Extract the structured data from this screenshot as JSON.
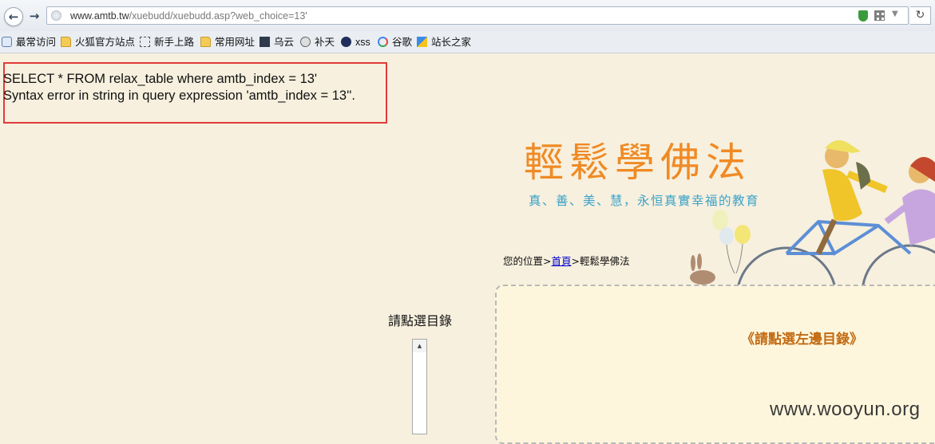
{
  "browser": {
    "url_host": "www.amtb.tw",
    "url_path": "/xuebudd/xuebudd.asp?web_choice=13'"
  },
  "bookmarks": [
    {
      "label": "最常访问",
      "icon": "star-page-icon"
    },
    {
      "label": "火狐官方站点",
      "icon": "folder-icon"
    },
    {
      "label": "新手上路",
      "icon": "dashed-page-icon"
    },
    {
      "label": "常用网址",
      "icon": "folder-icon"
    },
    {
      "label": "乌云",
      "icon": "wooyun-icon"
    },
    {
      "label": "补天",
      "icon": "star-icon"
    },
    {
      "label": "xss",
      "icon": "xss-icon"
    },
    {
      "label": "谷歌",
      "icon": "google-icon"
    },
    {
      "label": "站长之家",
      "icon": "zz-icon"
    }
  ],
  "error": {
    "line1": "SELECT * FROM relax_table where amtb_index = 13'",
    "line2": "Syntax error in string in query expression 'amtb_index = 13''."
  },
  "page": {
    "title": "輕鬆學佛法",
    "subtitle": "真、善、美、慧，永恒真實幸福的教育",
    "breadcrumb_prefix": "您的位置>",
    "breadcrumb_home": "首頁",
    "breadcrumb_current": ">輕鬆學佛法",
    "menu_title": "請點選目錄",
    "content_message": "《請點選左邊目錄》"
  },
  "watermark": "www.wooyun.org",
  "colors": {
    "page_bg": "#f7f0de",
    "title": "#f08a24",
    "subtitle": "#3aa2c9",
    "error_box": "#e23a3a",
    "content_msg": "#c26a12"
  }
}
